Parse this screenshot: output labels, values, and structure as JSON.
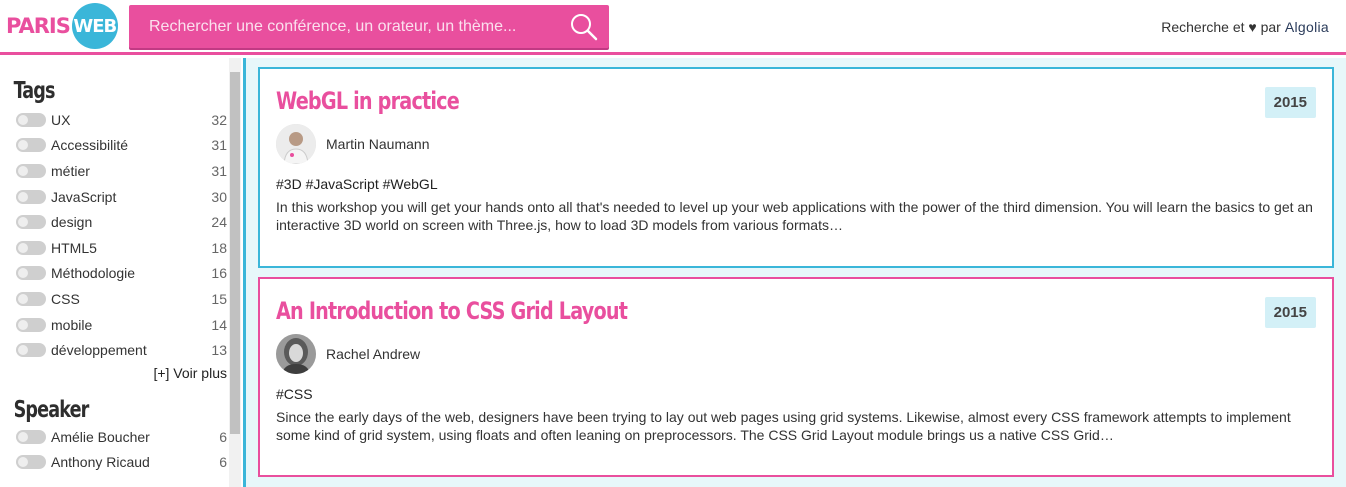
{
  "brand": {
    "logo_left": "PARIS",
    "logo_right": "WEB"
  },
  "search": {
    "placeholder": "Rechercher une conférence, un orateur, un thème...",
    "icon": "search-icon"
  },
  "credit": {
    "prefix": "Recherche et ♥ par",
    "provider": "Algolia"
  },
  "sidebar": {
    "tags": {
      "title": "Tags",
      "items": [
        {
          "label": "UX",
          "count": "32"
        },
        {
          "label": "Accessibilité",
          "count": "31"
        },
        {
          "label": "métier",
          "count": "31"
        },
        {
          "label": "JavaScript",
          "count": "30"
        },
        {
          "label": "design",
          "count": "24"
        },
        {
          "label": "HTML5",
          "count": "18"
        },
        {
          "label": "Méthodologie",
          "count": "16"
        },
        {
          "label": "CSS",
          "count": "15"
        },
        {
          "label": "mobile",
          "count": "14"
        },
        {
          "label": "développement",
          "count": "13"
        }
      ],
      "more": "[+] Voir plus"
    },
    "speaker": {
      "title": "Speaker",
      "items": [
        {
          "label": "Amélie Boucher",
          "count": "6"
        },
        {
          "label": "Anthony Ricaud",
          "count": "6"
        }
      ]
    }
  },
  "results": [
    {
      "title": "WebGL in practice",
      "year": "2015",
      "speaker": "Martin Naumann",
      "tags": "#3D #JavaScript #WebGL",
      "description": "In this workshop you will get your hands onto all that's needed to level up your web applications with the power of the third dimension. You will learn the basics to get an interactive 3D world on screen with Three.js, how to load 3D models from various formats…"
    },
    {
      "title": "An Introduction to CSS Grid Layout",
      "year": "2015",
      "speaker": "Rachel Andrew",
      "tags": "#CSS",
      "description": "Since the early days of the web, designers have been trying to lay out web pages using grid systems. Likewise, almost every CSS framework attempts to implement some kind of grid system, using floats and often leaning on preprocessors. The CSS Grid Layout module brings us a native CSS Grid…"
    }
  ],
  "colors": {
    "accent": "#e94f9e",
    "secondary": "#3ab6d9",
    "results_bg": "#e7f7fa"
  }
}
